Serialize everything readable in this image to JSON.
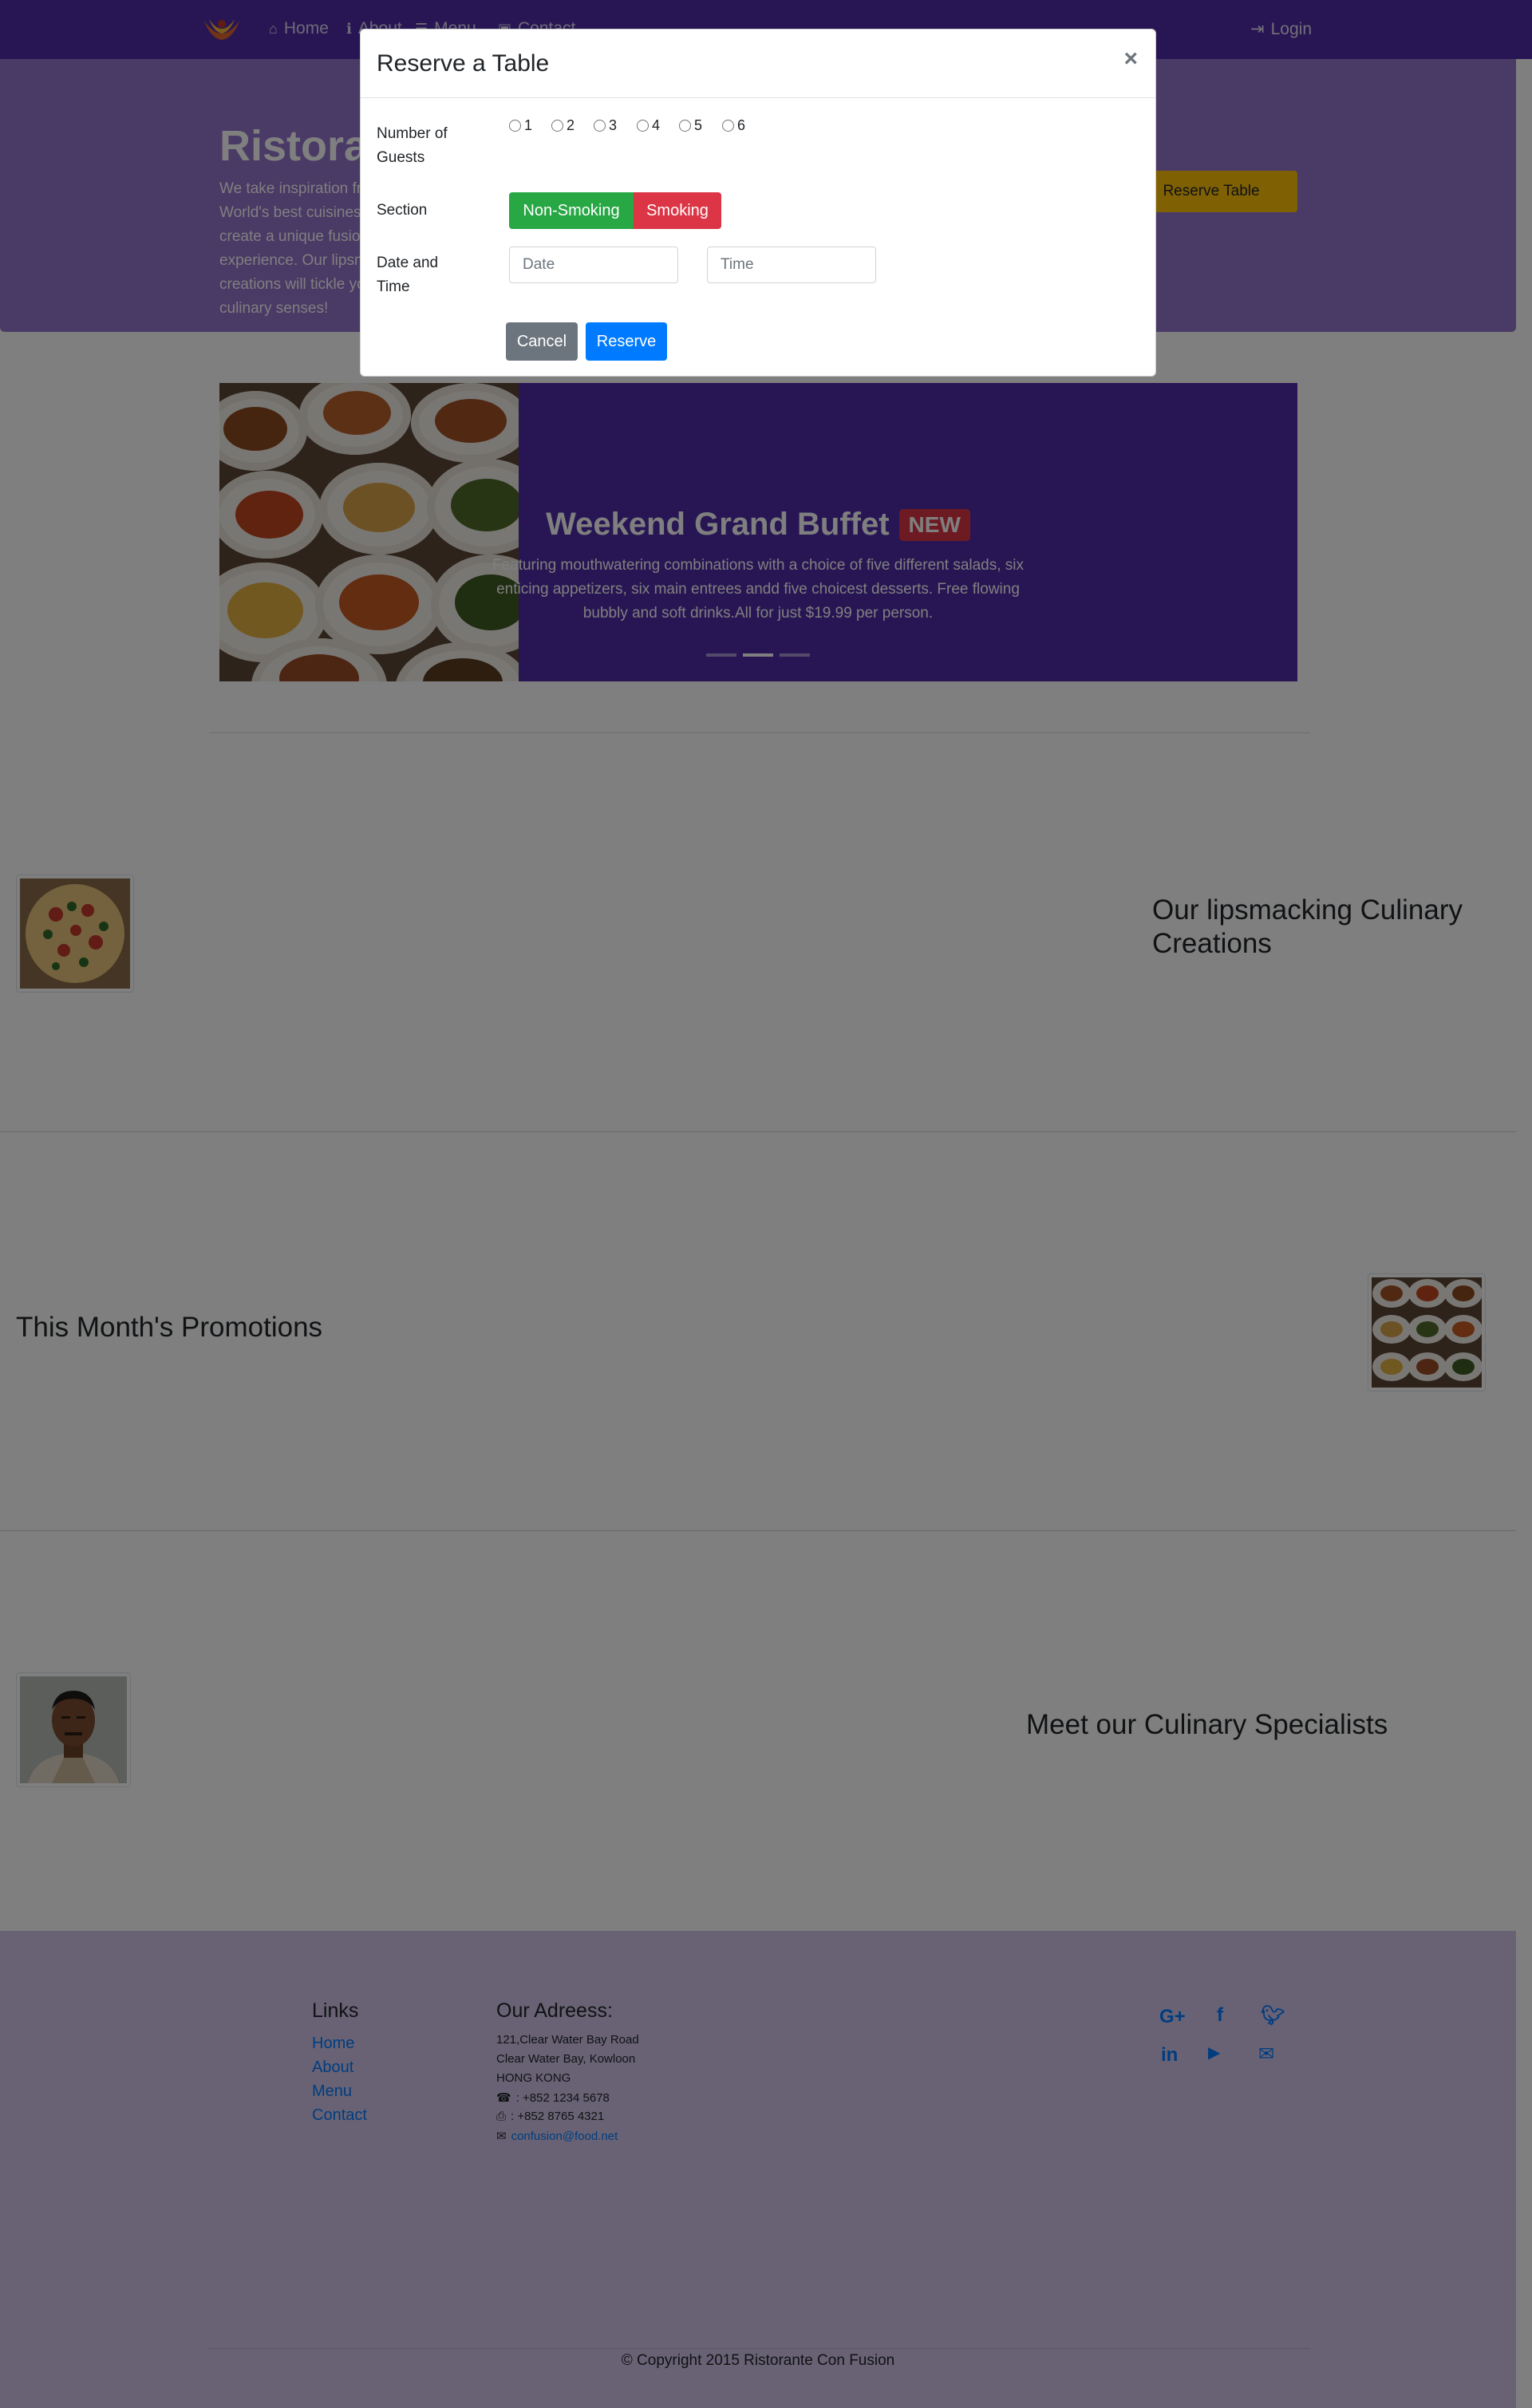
{
  "navbar": {
    "items": [
      {
        "icon": "home-icon",
        "label": "Home"
      },
      {
        "icon": "info-icon",
        "label": "About"
      },
      {
        "icon": "list-icon",
        "label": "Menu"
      },
      {
        "icon": "address-card-icon",
        "label": "Contact"
      }
    ],
    "login_label": "Login",
    "brand_color": "#512da8"
  },
  "jumbotron": {
    "title": "Ristorante Con Fusion",
    "text": "We take inspiration from the World's best cuisines, and create a unique fusion experience. Our lipsmacking creations will tickle your culinary senses!",
    "reserve_button": "Reserve Table"
  },
  "carousel": {
    "title": "Weekend Grand Buffet",
    "badge": "NEW",
    "text": "Featuring mouthwatering combinations with a choice of five different salads, six enticing appetizers, six main entrees andd five choicest desserts. Free flowing bubbly and soft drinks.All for just $19.99 per person.",
    "indicator_active": 2
  },
  "sections": {
    "culinary": "Our lipsmacking Culinary Creations",
    "promotions": "This Month's Promotions",
    "specialists": "Meet our Culinary Specialists"
  },
  "footer": {
    "links_heading": "Links",
    "links": [
      "Home",
      "About",
      "Menu",
      "Contact"
    ],
    "address_heading": "Our Adreess:",
    "address": [
      "121,Clear Water Bay Road",
      "Clear Water Bay, Kowloon",
      "HONG KONG"
    ],
    "phone": ": +852 1234 5678",
    "fax": ": +852 8765 4321",
    "email": "confusion@food.net",
    "social": [
      "google-plus-icon",
      "facebook-icon",
      "twitter-icon",
      "linkedin-icon",
      "youtube-icon",
      "envelope-icon"
    ],
    "copyright": "© Copyright 2015 Ristorante Con Fusion"
  },
  "modal": {
    "title": "Reserve a Table",
    "close": "×",
    "guests_label": "Number of Guests",
    "guest_options": [
      "1",
      "2",
      "3",
      "4",
      "5",
      "6"
    ],
    "section_label": "Section",
    "non_smoking": "Non-Smoking",
    "smoking": "Smoking",
    "datetime_label": "Date and Time",
    "date_placeholder": "Date",
    "time_placeholder": "Time",
    "cancel": "Cancel",
    "reserve": "Reserve"
  }
}
